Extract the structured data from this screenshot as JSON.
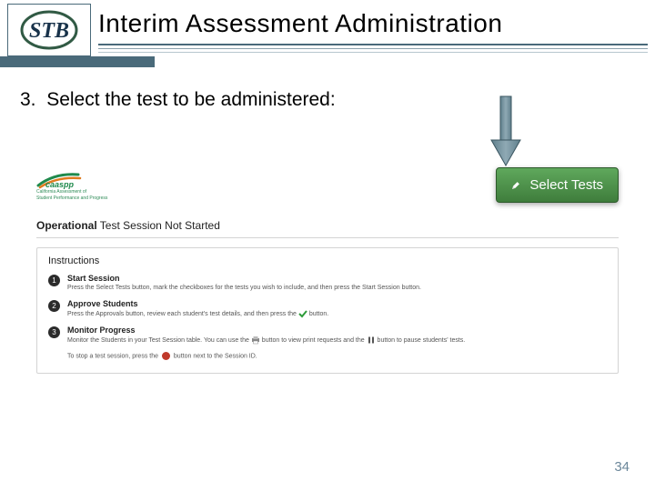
{
  "header": {
    "logo_text": "STB",
    "title": "Interim Assessment Administration"
  },
  "step": {
    "number": "3.",
    "text": "Select the test to be administered:"
  },
  "caaspp": {
    "name": "caaspp",
    "tagline1": "California Assessment of",
    "tagline2": "Student Performance and Progress"
  },
  "select_tests_button": "Select Tests",
  "session_status_bold": "Operational",
  "session_status_rest": " Test Session Not Started",
  "instructions": {
    "heading": "Instructions",
    "items": [
      {
        "num": "1",
        "title": "Start Session",
        "desc_before": "Press the Select Tests button, mark the checkboxes for the tests you wish to include, and then press the Start Session button.",
        "desc_after": ""
      },
      {
        "num": "2",
        "title": "Approve Students",
        "desc_before": "Press the Approvals button, review each student's test details, and then press the ",
        "desc_after": " button."
      },
      {
        "num": "3",
        "title": "Monitor Progress",
        "desc_before": "Monitor the Students in your Test Session table. You can use the ",
        "desc_mid": " button to view print requests and the ",
        "desc_after": " button to pause students' tests."
      }
    ],
    "stop_before": "To stop a test session, press the ",
    "stop_after": " button next to the Session ID."
  },
  "page_number": "34"
}
